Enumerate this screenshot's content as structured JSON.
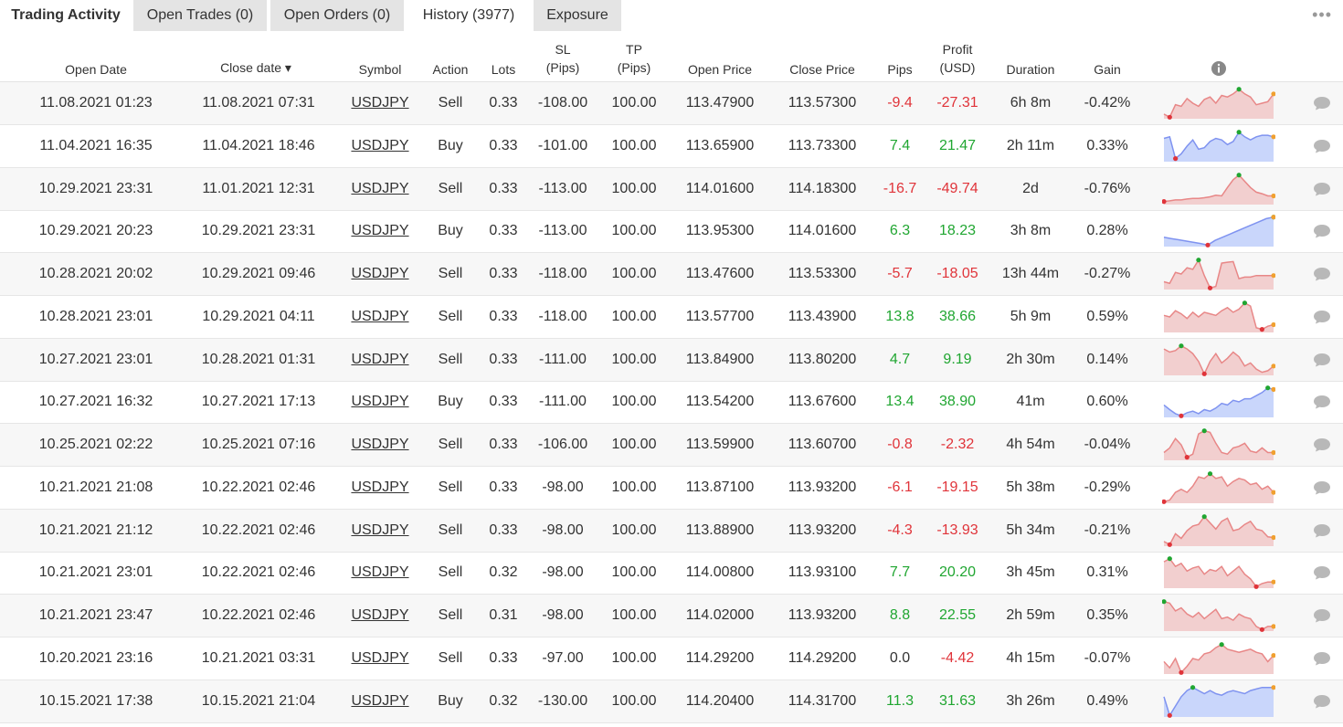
{
  "tabs": {
    "title": "Trading Activity",
    "items": [
      {
        "label": "Open Trades (0)",
        "active": false
      },
      {
        "label": "Open Orders (0)",
        "active": false
      },
      {
        "label": "History (3977)",
        "active": true
      },
      {
        "label": "Exposure",
        "active": false
      }
    ]
  },
  "menu_dots": "•••",
  "headers": {
    "open_date": "Open Date",
    "close_date": "Close date ▾",
    "symbol": "Symbol",
    "action": "Action",
    "lots": "Lots",
    "sl_1": "SL",
    "sl_2": "(Pips)",
    "tp_1": "TP",
    "tp_2": "(Pips)",
    "open_price": "Open Price",
    "close_price": "Close Price",
    "pips": "Pips",
    "profit_1": "Profit",
    "profit_2": "(USD)",
    "duration": "Duration",
    "gain": "Gain"
  },
  "colors": {
    "positive": "#20a631",
    "negative": "#e0343a",
    "sell_fill": "#f2cfcf",
    "sell_line": "#e88787",
    "buy_fill": "#c9d6fb",
    "buy_line": "#7f93f0",
    "start_dot": "#e0343a",
    "peak_dot": "#20a631",
    "end_dot": "#f0a030"
  },
  "rows": [
    {
      "open": "11.08.2021 01:23",
      "close": "11.08.2021 07:31",
      "symbol": "USDJPY",
      "action": "Sell",
      "lots": "0.33",
      "sl": "-108.00",
      "tp": "100.00",
      "open_price": "113.47900",
      "close_price": "113.57300",
      "pips": "-9.4",
      "profit": "-27.31",
      "duration": "6h 8m",
      "gain": "-0.42%",
      "trend": [
        0.85,
        0.95,
        0.55,
        0.6,
        0.35,
        0.5,
        0.6,
        0.38,
        0.3,
        0.5,
        0.25,
        0.3,
        0.2,
        0.05,
        0.2,
        0.3,
        0.55,
        0.5,
        0.45,
        0.2
      ]
    },
    {
      "open": "11.04.2021 16:35",
      "close": "11.04.2021 18:46",
      "symbol": "USDJPY",
      "action": "Buy",
      "lots": "0.33",
      "sl": "-101.00",
      "tp": "100.00",
      "open_price": "113.65900",
      "close_price": "113.73300",
      "pips": "7.4",
      "profit": "21.47",
      "duration": "2h 11m",
      "gain": "0.33%",
      "trend": [
        0.25,
        0.2,
        0.9,
        0.75,
        0.5,
        0.3,
        0.6,
        0.55,
        0.35,
        0.25,
        0.3,
        0.45,
        0.35,
        0.05,
        0.2,
        0.3,
        0.2,
        0.15,
        0.15,
        0.2
      ]
    },
    {
      "open": "10.29.2021 23:31",
      "close": "11.01.2021 12:31",
      "symbol": "USDJPY",
      "action": "Sell",
      "lots": "0.33",
      "sl": "-113.00",
      "tp": "100.00",
      "open_price": "114.01600",
      "close_price": "114.18300",
      "pips": "-16.7",
      "profit": "-49.74",
      "duration": "2d",
      "gain": "-0.76%",
      "trend": [
        0.9,
        0.88,
        0.85,
        0.85,
        0.82,
        0.8,
        0.8,
        0.78,
        0.75,
        0.7,
        0.72,
        0.45,
        0.2,
        0.05,
        0.25,
        0.45,
        0.6,
        0.65,
        0.72,
        0.72
      ]
    },
    {
      "open": "10.29.2021 20:23",
      "close": "10.29.2021 23:31",
      "symbol": "USDJPY",
      "action": "Buy",
      "lots": "0.33",
      "sl": "-113.00",
      "tp": "100.00",
      "open_price": "113.95300",
      "close_price": "114.01600",
      "pips": "6.3",
      "profit": "18.23",
      "duration": "3h 8m",
      "gain": "0.28%",
      "trend": [
        0.7,
        0.74,
        0.78,
        0.82,
        0.86,
        0.9,
        0.95,
        0.8,
        0.7,
        0.6,
        0.5,
        0.4,
        0.3,
        0.2,
        0.1,
        0.05
      ]
    },
    {
      "open": "10.28.2021 20:02",
      "close": "10.29.2021 09:46",
      "symbol": "USDJPY",
      "action": "Sell",
      "lots": "0.33",
      "sl": "-118.00",
      "tp": "100.00",
      "open_price": "113.47600",
      "close_price": "113.53300",
      "pips": "-5.7",
      "profit": "-18.05",
      "duration": "13h 44m",
      "gain": "-0.27%",
      "trend": [
        0.75,
        0.8,
        0.45,
        0.5,
        0.3,
        0.35,
        0.05,
        0.55,
        0.95,
        0.9,
        0.15,
        0.12,
        0.1,
        0.65,
        0.6,
        0.6,
        0.55,
        0.55,
        0.55,
        0.55
      ]
    },
    {
      "open": "10.28.2021 23:01",
      "close": "10.29.2021 04:11",
      "symbol": "USDJPY",
      "action": "Sell",
      "lots": "0.33",
      "sl": "-118.00",
      "tp": "100.00",
      "open_price": "113.57700",
      "close_price": "113.43900",
      "pips": "13.8",
      "profit": "38.66",
      "duration": "5h 9m",
      "gain": "0.59%",
      "trend": [
        0.45,
        0.5,
        0.3,
        0.4,
        0.55,
        0.35,
        0.5,
        0.35,
        0.4,
        0.45,
        0.3,
        0.2,
        0.35,
        0.25,
        0.05,
        0.15,
        0.85,
        0.9,
        0.8,
        0.75
      ]
    },
    {
      "open": "10.27.2021 23:01",
      "close": "10.28.2021 01:31",
      "symbol": "USDJPY",
      "action": "Sell",
      "lots": "0.33",
      "sl": "-111.00",
      "tp": "100.00",
      "open_price": "113.84900",
      "close_price": "113.80200",
      "pips": "4.7",
      "profit": "9.19",
      "duration": "2h 30m",
      "gain": "0.14%",
      "trend": [
        0.15,
        0.25,
        0.2,
        0.05,
        0.15,
        0.3,
        0.55,
        0.95,
        0.55,
        0.3,
        0.6,
        0.45,
        0.25,
        0.4,
        0.7,
        0.6,
        0.8,
        0.9,
        0.85,
        0.7
      ]
    },
    {
      "open": "10.27.2021 16:32",
      "close": "10.27.2021 17:13",
      "symbol": "USDJPY",
      "action": "Buy",
      "lots": "0.33",
      "sl": "-111.00",
      "tp": "100.00",
      "open_price": "113.54200",
      "close_price": "113.67600",
      "pips": "13.4",
      "profit": "38.90",
      "duration": "41m",
      "gain": "0.60%",
      "trend": [
        0.6,
        0.75,
        0.88,
        0.95,
        0.85,
        0.8,
        0.88,
        0.75,
        0.8,
        0.7,
        0.55,
        0.6,
        0.45,
        0.5,
        0.4,
        0.4,
        0.3,
        0.2,
        0.05,
        0.1
      ]
    },
    {
      "open": "10.25.2021 02:22",
      "close": "10.25.2021 07:16",
      "symbol": "USDJPY",
      "action": "Sell",
      "lots": "0.33",
      "sl": "-106.00",
      "tp": "100.00",
      "open_price": "113.59900",
      "close_price": "113.60700",
      "pips": "-0.8",
      "profit": "-2.32",
      "duration": "4h 54m",
      "gain": "-0.04%",
      "trend": [
        0.75,
        0.6,
        0.3,
        0.5,
        0.9,
        0.8,
        0.15,
        0.05,
        0.1,
        0.45,
        0.75,
        0.8,
        0.6,
        0.55,
        0.45,
        0.7,
        0.75,
        0.6,
        0.75,
        0.75
      ]
    },
    {
      "open": "10.21.2021 21:08",
      "close": "10.22.2021 02:46",
      "symbol": "USDJPY",
      "action": "Sell",
      "lots": "0.33",
      "sl": "-98.00",
      "tp": "100.00",
      "open_price": "113.87100",
      "close_price": "113.93200",
      "pips": "-6.1",
      "profit": "-19.15",
      "duration": "5h 38m",
      "gain": "-0.29%",
      "trend": [
        0.95,
        0.9,
        0.65,
        0.55,
        0.65,
        0.45,
        0.15,
        0.2,
        0.05,
        0.2,
        0.15,
        0.45,
        0.3,
        0.2,
        0.25,
        0.4,
        0.35,
        0.55,
        0.45,
        0.65
      ]
    },
    {
      "open": "10.21.2021 21:12",
      "close": "10.22.2021 02:46",
      "symbol": "USDJPY",
      "action": "Sell",
      "lots": "0.33",
      "sl": "-98.00",
      "tp": "100.00",
      "open_price": "113.88900",
      "close_price": "113.93200",
      "pips": "-4.3",
      "profit": "-13.93",
      "duration": "5h 34m",
      "gain": "-0.21%",
      "trend": [
        0.85,
        0.95,
        0.6,
        0.75,
        0.5,
        0.35,
        0.3,
        0.05,
        0.25,
        0.45,
        0.2,
        0.1,
        0.5,
        0.45,
        0.3,
        0.2,
        0.45,
        0.5,
        0.7,
        0.72
      ]
    },
    {
      "open": "10.21.2021 23:01",
      "close": "10.22.2021 02:46",
      "symbol": "USDJPY",
      "action": "Sell",
      "lots": "0.32",
      "sl": "-98.00",
      "tp": "100.00",
      "open_price": "114.00800",
      "close_price": "113.93100",
      "pips": "7.7",
      "profit": "20.20",
      "duration": "3h 45m",
      "gain": "0.31%",
      "trend": [
        0.15,
        0.05,
        0.3,
        0.2,
        0.45,
        0.35,
        0.3,
        0.55,
        0.4,
        0.45,
        0.3,
        0.6,
        0.45,
        0.3,
        0.55,
        0.7,
        0.95,
        0.85,
        0.8,
        0.8
      ]
    },
    {
      "open": "10.21.2021 23:47",
      "close": "10.22.2021 02:46",
      "symbol": "USDJPY",
      "action": "Sell",
      "lots": "0.31",
      "sl": "-98.00",
      "tp": "100.00",
      "open_price": "114.02000",
      "close_price": "113.93200",
      "pips": "8.8",
      "profit": "22.55",
      "duration": "2h 59m",
      "gain": "0.35%",
      "trend": [
        0.05,
        0.1,
        0.35,
        0.25,
        0.45,
        0.55,
        0.4,
        0.6,
        0.45,
        0.3,
        0.6,
        0.55,
        0.65,
        0.45,
        0.55,
        0.6,
        0.85,
        0.95,
        0.85,
        0.85
      ]
    },
    {
      "open": "10.20.2021 23:16",
      "close": "10.21.2021 03:31",
      "symbol": "USDJPY",
      "action": "Sell",
      "lots": "0.33",
      "sl": "-97.00",
      "tp": "100.00",
      "open_price": "114.29200",
      "close_price": "114.29200",
      "pips": "0.0",
      "profit": "-4.42",
      "duration": "4h 15m",
      "gain": "-0.07%",
      "trend": [
        0.6,
        0.8,
        0.5,
        0.95,
        0.75,
        0.5,
        0.55,
        0.35,
        0.3,
        0.15,
        0.05,
        0.2,
        0.25,
        0.3,
        0.25,
        0.2,
        0.3,
        0.35,
        0.6,
        0.4
      ]
    },
    {
      "open": "10.15.2021 17:38",
      "close": "10.15.2021 21:04",
      "symbol": "USDJPY",
      "action": "Buy",
      "lots": "0.32",
      "sl": "-130.00",
      "tp": "100.00",
      "open_price": "114.20400",
      "close_price": "114.31700",
      "pips": "11.3",
      "profit": "31.63",
      "duration": "3h 26m",
      "gain": "0.49%",
      "trend": [
        0.35,
        0.95,
        0.65,
        0.35,
        0.15,
        0.05,
        0.15,
        0.25,
        0.15,
        0.25,
        0.3,
        0.2,
        0.15,
        0.2,
        0.25,
        0.15,
        0.1,
        0.05,
        0.05,
        0.05
      ]
    }
  ]
}
